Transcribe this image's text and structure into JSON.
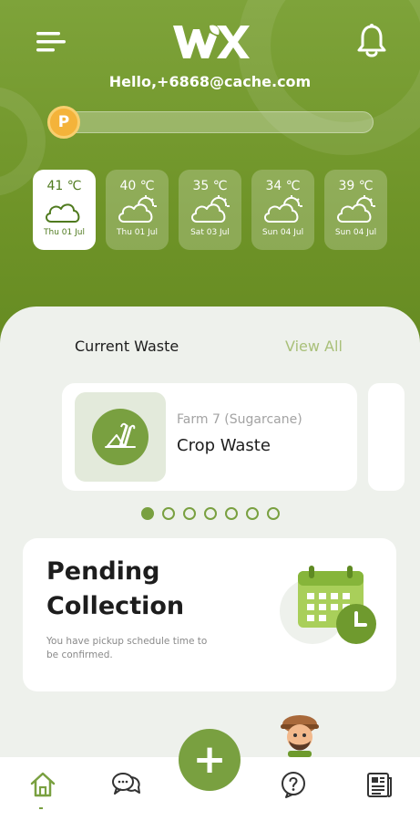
{
  "header": {
    "logo_text": "WX",
    "greeting": "Hello,+6868@cache.com",
    "points_badge": "P",
    "points_progress": 0.0,
    "colors": {
      "brand_green": "#79a040",
      "header_green": "#6f9428",
      "points_gold": "#f4b33a"
    },
    "icons": {
      "menu": "menu-icon",
      "notifications": "bell-icon"
    }
  },
  "weather": [
    {
      "temp": "41 ℃",
      "date": "Thu 01 Jul",
      "icon": "cloud-icon",
      "selected": true
    },
    {
      "temp": "40 ℃",
      "date": "Thu 01 Jul",
      "icon": "cloud-sun-icon",
      "selected": false
    },
    {
      "temp": "35 ℃",
      "date": "Sat 03 Jul",
      "icon": "cloud-sun-icon",
      "selected": false
    },
    {
      "temp": "34 ℃",
      "date": "Sun 04 Jul",
      "icon": "cloud-sun-icon",
      "selected": false
    },
    {
      "temp": "39 ℃",
      "date": "Sun 04 Jul",
      "icon": "cloud-sun-icon",
      "selected": false
    }
  ],
  "current_waste": {
    "title": "Current Waste",
    "view_all": "View All",
    "cards": [
      {
        "farm": "Farm 7 (Sugarcane)",
        "name": "Crop Waste",
        "icon": "sugarcane-icon"
      }
    ],
    "pager": {
      "total": 7,
      "active": 0
    }
  },
  "pending": {
    "title": "Pending Collection",
    "description": "You have pickup schedule time to be confirmed.",
    "icon": "calendar-clock-icon"
  },
  "bottom_nav": {
    "items": [
      {
        "name": "home",
        "icon": "home-icon",
        "active": true
      },
      {
        "name": "chat",
        "icon": "chat-icon",
        "active": false
      },
      {
        "name": "add",
        "icon": "plus-icon",
        "label": "+"
      },
      {
        "name": "help",
        "icon": "help-icon",
        "active": false
      },
      {
        "name": "news",
        "icon": "news-icon",
        "active": false
      }
    ]
  }
}
